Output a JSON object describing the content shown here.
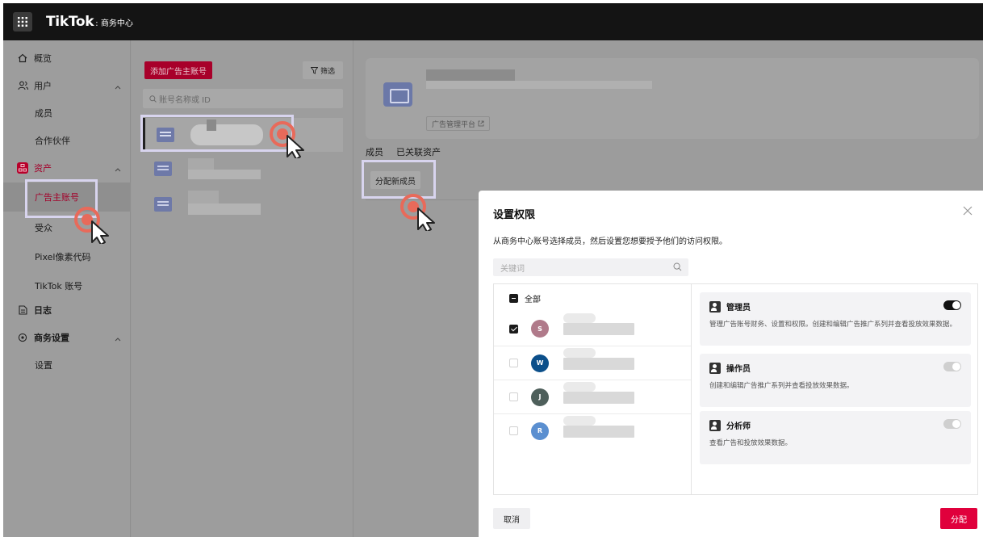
{
  "topbar": {
    "brand": "TikTok",
    "brand_sub": ": 商务中心"
  },
  "sidebar": {
    "items": [
      {
        "label": "概览"
      },
      {
        "label": "用户"
      },
      {
        "label": "成员"
      },
      {
        "label": "合作伙伴"
      },
      {
        "label": "资产"
      },
      {
        "label": "广告主账号"
      },
      {
        "label": "受众"
      },
      {
        "label": "Pixel像素代码"
      },
      {
        "label": "TikTok 账号"
      },
      {
        "label": "日志"
      },
      {
        "label": "商务设置"
      },
      {
        "label": "设置"
      }
    ]
  },
  "accounts_panel": {
    "add_button": "添加广告主账号",
    "filter_button": "筛选",
    "search_placeholder": "账号名称或 ID"
  },
  "detail": {
    "platform_link": "广告管理平台",
    "tabs": [
      "成员",
      "已关联资产"
    ],
    "assign_member_button": "分配新成员"
  },
  "modal": {
    "title": "设置权限",
    "description": "从商务中心账号选择成员，然后设置您想要授予他们的访问权限。",
    "search_placeholder": "关键词",
    "select_all_label": "全部",
    "members": [
      {
        "initial": "S",
        "color": "#b07a8a",
        "checked": true
      },
      {
        "initial": "W",
        "color": "#0b4f8a",
        "checked": false
      },
      {
        "initial": "J",
        "color": "#4e5f5b",
        "checked": false
      },
      {
        "initial": "R",
        "color": "#5b8fd0",
        "checked": false
      }
    ],
    "roles": [
      {
        "name": "管理员",
        "description": "管理广告账号财务、设置和权限。创建和编辑广告推广系列并查看投放效果数据。",
        "enabled": true
      },
      {
        "name": "操作员",
        "description": "创建和编辑广告推广系列并查看投放效果数据。",
        "enabled": false
      },
      {
        "name": "分析师",
        "description": "查看广告和投放效果数据。",
        "enabled": false
      }
    ],
    "cancel_button": "取消",
    "assign_button": "分配"
  },
  "colors": {
    "brand": "#e0003c",
    "accent_dark": "#a8002a"
  }
}
